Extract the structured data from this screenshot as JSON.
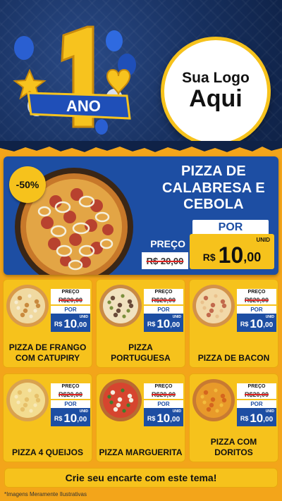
{
  "badge": {
    "number": "1",
    "label": "ANO"
  },
  "logo": {
    "line1": "Sua Logo",
    "line2": "Aqui"
  },
  "hero": {
    "discount": "-50%",
    "title": "PIZZA DE CALABRESA E CEBOLA",
    "price_label": "PREÇO",
    "old_price": "R$ 20,00",
    "por_label": "POR",
    "unit_label": "UNID",
    "currency": "R$",
    "new_price_int": "10",
    "new_price_dec": ",00"
  },
  "products": [
    {
      "name": "PIZZA DE FRANGO COM CATUPIRY",
      "price_label": "PREÇO",
      "old_price": "R$20,00",
      "por_label": "POR",
      "unit_label": "UNID",
      "currency": "R$",
      "new_price_int": "10",
      "new_price_dec": ",00",
      "topping": "chicken"
    },
    {
      "name": "PIZZA PORTUGUESA",
      "price_label": "PREÇO",
      "old_price": "R$20,00",
      "por_label": "POR",
      "unit_label": "UNID",
      "currency": "R$",
      "new_price_int": "10",
      "new_price_dec": ",00",
      "topping": "portuguesa"
    },
    {
      "name": "PIZZA DE BACON",
      "price_label": "PREÇO",
      "old_price": "R$20,00",
      "por_label": "POR",
      "unit_label": "UNID",
      "currency": "R$",
      "new_price_int": "10",
      "new_price_dec": ",00",
      "topping": "bacon"
    },
    {
      "name": "PIZZA 4 QUEIJOS",
      "price_label": "PREÇO",
      "old_price": "R$20,00",
      "por_label": "POR",
      "unit_label": "UNID",
      "currency": "R$",
      "new_price_int": "10",
      "new_price_dec": ",00",
      "topping": "cheese"
    },
    {
      "name": "PIZZA MARGUERITA",
      "price_label": "PREÇO",
      "old_price": "R$20,00",
      "por_label": "POR",
      "unit_label": "UNID",
      "currency": "R$",
      "new_price_int": "10",
      "new_price_dec": ",00",
      "topping": "margherita"
    },
    {
      "name": "PIZZA COM DORITOS",
      "price_label": "PREÇO",
      "old_price": "R$20,00",
      "por_label": "POR",
      "unit_label": "UNID",
      "currency": "R$",
      "new_price_int": "10",
      "new_price_dec": ",00",
      "topping": "doritos"
    }
  ],
  "cta": "Crie seu encarte com este tema!",
  "disclaimer": "*Imagens Meramente Ilustrativas",
  "colors": {
    "navy": "#17305f",
    "blue": "#1d4ea3",
    "yellow": "#f6c21c",
    "orange": "#f3a51a"
  }
}
